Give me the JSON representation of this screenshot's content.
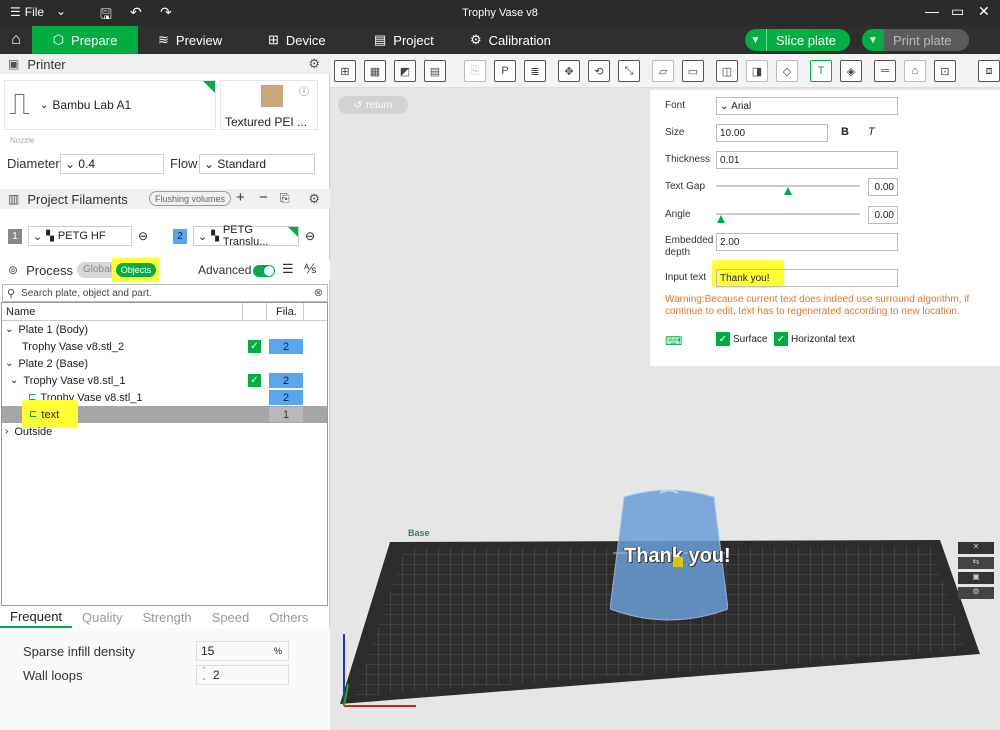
{
  "titlebar": {
    "menu_label": "File",
    "title": "Trophy Vase v8",
    "icons": [
      "save-icon",
      "undo-icon",
      "redo-icon"
    ]
  },
  "nav": {
    "tabs": [
      "Prepare",
      "Preview",
      "Device",
      "Project",
      "Calibration"
    ],
    "active": "Prepare",
    "slice": "Slice plate",
    "print": "Print plate"
  },
  "printer": {
    "section": "Printer",
    "model": "Bambu Lab A1",
    "plate": "Textured PEI ...",
    "nozzle_label": "Nozzle",
    "diameter_label": "Diameter",
    "diameter": "0.4",
    "flow_label": "Flow",
    "flow": "Standard"
  },
  "filaments": {
    "section": "Project Filaments",
    "flushing": "Flushing volumes",
    "items": [
      {
        "num": "1",
        "name": "PETG HF"
      },
      {
        "num": "2",
        "name": "PETG Translu..."
      }
    ]
  },
  "process": {
    "section": "Process",
    "global": "Global",
    "objects": "Objects",
    "advanced": "Advanced",
    "search_placeholder": "Search plate, object and part."
  },
  "tree": {
    "col_name": "Name",
    "col_fila": "Fila.",
    "rows": [
      {
        "text": "Plate 1 (Body)",
        "prefix": "v"
      },
      {
        "text": "Trophy Vase v8.stl_2",
        "fila": "2"
      },
      {
        "text": "Plate 2 (Base)",
        "prefix": "v"
      },
      {
        "text": "Trophy Vase v8.stl_1",
        "fila": "2",
        "prefix": "v"
      },
      {
        "text": "Trophy Vase v8.stl_1",
        "fila": "2"
      },
      {
        "text": "text",
        "fila": "1"
      },
      {
        "text": "Outside",
        "prefix": ">"
      }
    ]
  },
  "settings_tabs": [
    "Frequent",
    "Quality",
    "Strength",
    "Speed",
    "Others"
  ],
  "settings": {
    "infill_label": "Sparse infill density",
    "infill": "15",
    "infill_unit": "%",
    "walls_label": "Wall loops",
    "walls": "2"
  },
  "viewport": {
    "return": "return",
    "plate_text": "Thank you!",
    "plate_label": "Base"
  },
  "text_panel": {
    "font_label": "Font",
    "font": "Arial",
    "size_label": "Size",
    "size": "10.00",
    "bold": "B",
    "italic": "T",
    "thickness_label": "Thickness",
    "thickness": "0.01",
    "gap_label": "Text Gap",
    "gap": "0.00",
    "angle_label": "Angle",
    "angle": "0.00",
    "embed_label1": "Embedded",
    "embed_label2": "depth",
    "embed": "2.00",
    "input_label": "Input text",
    "input": "Thank you!",
    "warning": "Warning:Because current text does indeed use surround algorithm, if continue to edit, text has to regenerated according to new location.",
    "surface": "Surface",
    "horizontal": "Horizontal text"
  }
}
